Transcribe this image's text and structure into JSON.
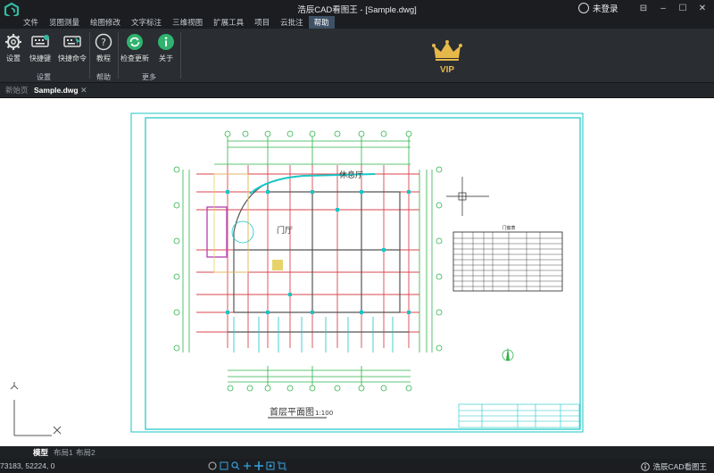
{
  "app": {
    "title": "浩辰CAD看图王 - [Sample.dwg]",
    "user_label": "未登录"
  },
  "window_buttons": [
    "⊟",
    "–",
    "☐",
    "✕"
  ],
  "menu": [
    "文件",
    "览图测量",
    "绘图修改",
    "文字标注",
    "三维视图",
    "扩展工具",
    "项目",
    "云批注",
    "帮助"
  ],
  "menu_active": "帮助",
  "ribbon": {
    "buttons": {
      "settings": "设置",
      "shortcut_keys": "快捷键",
      "shortcut_commands": "快捷命令",
      "tutorial": "教程",
      "check_update": "检查更新",
      "about": "关于"
    },
    "groups": {
      "settings": "设置",
      "help": "帮助",
      "more": "更多"
    },
    "vip": "VIP"
  },
  "tabs": {
    "home": "新始页",
    "document": "Sample.dwg"
  },
  "drawing": {
    "title": "首层平面图",
    "scale": "1:100",
    "room_lounge": "休息厅",
    "room_hall": "门厅",
    "table_title": "门窗表"
  },
  "layouts": [
    "模型",
    "布局1",
    "布局2"
  ],
  "status": {
    "coords": "73183, 52224, 0",
    "brand": "浩辰CAD看图王"
  },
  "colors": {
    "accent": "#3e5166",
    "brand_green": "#35b8a0",
    "vip_gold": "#e6b84a"
  }
}
